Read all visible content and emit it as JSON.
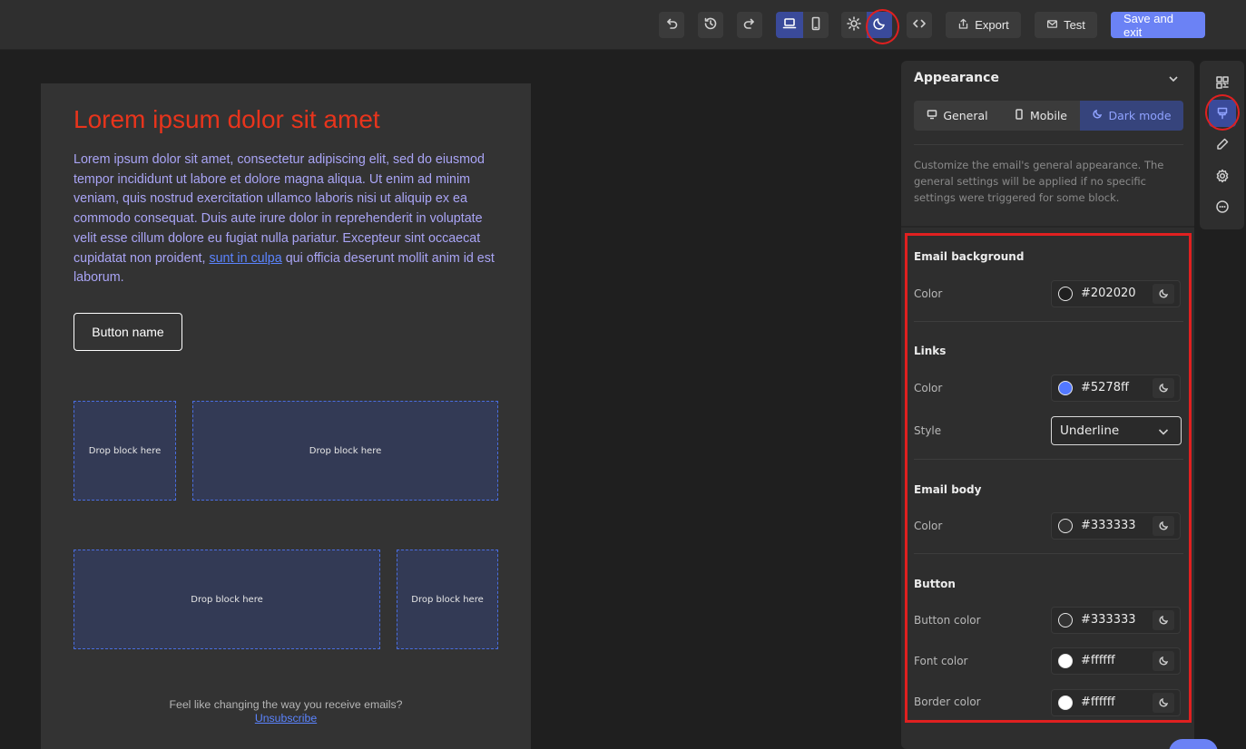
{
  "toolbar": {
    "undo_icon": "undo-icon",
    "history_icon": "history-icon",
    "redo_icon": "redo-icon",
    "desktop_icon": "desktop-icon",
    "mobile_icon": "mobile-icon",
    "light_icon": "sun-icon",
    "dark_icon": "moon-icon",
    "code_icon": "code-icon",
    "export_label": "Export",
    "test_label": "Test",
    "save_label": "Save and exit"
  },
  "email": {
    "title": "Lorem ipsum dolor sit amet",
    "body_before_link": "Lorem ipsum dolor sit amet, consectetur adipiscing elit, sed do eiusmod tempor incididunt ut labore et dolore magna aliqua. Ut enim ad minim veniam, quis nostrud exercitation ullamco laboris nisi ut aliquip ex ea commodo consequat. Duis aute irure dolor in reprehenderit in voluptate velit esse cillum dolore eu fugiat nulla pariatur. Excepteur sint occaecat cupidatat non proident, ",
    "body_link": "sunt in culpa",
    "body_after_link": " qui officia deserunt mollit anim id est laborum.",
    "button_label": "Button name",
    "drop_label": "Drop block here",
    "footer_text": "Feel like changing the way you receive emails?",
    "footer_link": "Unsubscribe"
  },
  "panel": {
    "title": "Appearance",
    "tabs": [
      {
        "label": "General",
        "icon": "monitor-icon"
      },
      {
        "label": "Mobile",
        "icon": "phone-icon"
      },
      {
        "label": "Dark mode",
        "icon": "moon-icon"
      }
    ],
    "description": "Customize the email's general appearance. The general settings will be applied if no specific settings were triggered for some block.",
    "email_background": {
      "title": "Email background",
      "color_label": "Color",
      "color_value": "#202020"
    },
    "links": {
      "title": "Links",
      "color_label": "Color",
      "color_value": "#5278ff",
      "style_label": "Style",
      "style_value": "Underline"
    },
    "email_body": {
      "title": "Email body",
      "color_label": "Color",
      "color_value": "#333333"
    },
    "button": {
      "title": "Button",
      "button_color_label": "Button color",
      "button_color_value": "#333333",
      "font_color_label": "Font color",
      "font_color_value": "#ffffff",
      "border_color_label": "Border color",
      "border_color_value": "#ffffff"
    }
  },
  "rail": [
    "blocks-icon",
    "paint-icon",
    "pencil-icon",
    "gear-icon",
    "chat-icon"
  ],
  "colors": {
    "accent": "#6b82f5",
    "title_red": "#e8341c",
    "body_text": "#a9a4f5",
    "link": "#5278ff",
    "annotation_red": "#e02020"
  }
}
